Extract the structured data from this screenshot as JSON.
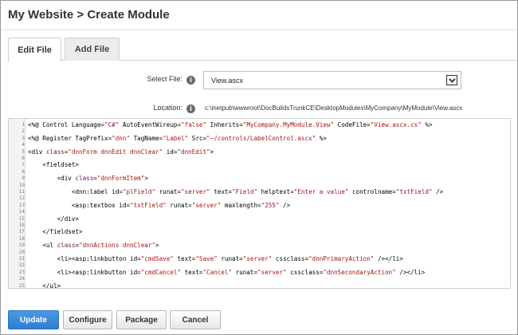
{
  "page": {
    "title": "My Website > Create Module"
  },
  "tabs": [
    {
      "label": "Edit File",
      "active": true
    },
    {
      "label": "Add File",
      "active": false
    }
  ],
  "form": {
    "select_file_label": "Select File:",
    "select_file_value": "View.ascx",
    "location_label": "Location:",
    "location_value": "c:\\inetpub\\wwwroot\\DocBuildsTrunkCE\\DesktopModules\\MyCompany\\MyModule\\View.ascx",
    "info_glyph": "i"
  },
  "editor": {
    "line_numbers": [
      "1",
      "2",
      "3",
      "4",
      "5",
      "6",
      "7",
      "8",
      "9",
      "10",
      "11",
      "12",
      "13",
      "14",
      "15",
      "16",
      "17",
      "18",
      "19",
      "20",
      "21",
      "22",
      "23",
      "24",
      "25"
    ],
    "code_lines": [
      [
        {
          "t": "<%@ Control Language=",
          "c": ""
        },
        {
          "t": "\"C#\"",
          "c": "str"
        },
        {
          "t": " AutoEventWireup=",
          "c": ""
        },
        {
          "t": "\"false\"",
          "c": "str"
        },
        {
          "t": " Inherits=",
          "c": ""
        },
        {
          "t": "\"MyCompany.MyModule.View\"",
          "c": "str"
        },
        {
          "t": " CodeFile=",
          "c": ""
        },
        {
          "t": "\"View.ascx.cs\"",
          "c": "str"
        },
        {
          "t": " %>",
          "c": ""
        }
      ],
      [
        {
          "t": "<%@ Register TagPrefix=",
          "c": ""
        },
        {
          "t": "\"dnn\"",
          "c": "str"
        },
        {
          "t": " TagName=",
          "c": ""
        },
        {
          "t": "\"Label\"",
          "c": "str"
        },
        {
          "t": " Src=",
          "c": ""
        },
        {
          "t": "\"~/controls/LabelControl.ascx\"",
          "c": "str"
        },
        {
          "t": " %>",
          "c": ""
        }
      ],
      [
        {
          "t": "<div ",
          "c": ""
        },
        {
          "t": "class",
          "c": "kw"
        },
        {
          "t": "=",
          "c": ""
        },
        {
          "t": "\"dnnForm dnnEdit dnnClear\"",
          "c": "str"
        },
        {
          "t": " id=",
          "c": ""
        },
        {
          "t": "\"dnnEdit\"",
          "c": "str"
        },
        {
          "t": ">",
          "c": ""
        }
      ],
      [
        {
          "t": "    <fieldset>",
          "c": ""
        }
      ],
      [
        {
          "t": "        <div ",
          "c": ""
        },
        {
          "t": "class",
          "c": "kw"
        },
        {
          "t": "=",
          "c": ""
        },
        {
          "t": "\"dnnFormItem\"",
          "c": "str"
        },
        {
          "t": ">",
          "c": ""
        }
      ],
      [
        {
          "t": "            <dnn:label id=",
          "c": ""
        },
        {
          "t": "\"plField\"",
          "c": "str"
        },
        {
          "t": " runat=",
          "c": ""
        },
        {
          "t": "\"server\"",
          "c": "str"
        },
        {
          "t": " text=",
          "c": ""
        },
        {
          "t": "\"Field\"",
          "c": "str"
        },
        {
          "t": " helptext=",
          "c": ""
        },
        {
          "t": "\"Enter a value\"",
          "c": "str"
        },
        {
          "t": " controlname=",
          "c": ""
        },
        {
          "t": "\"txtField\"",
          "c": "str"
        },
        {
          "t": " />",
          "c": ""
        }
      ],
      [
        {
          "t": "            <asp:textbox id=",
          "c": ""
        },
        {
          "t": "\"txtField\"",
          "c": "str"
        },
        {
          "t": " runat=",
          "c": ""
        },
        {
          "t": "\"server\"",
          "c": "str"
        },
        {
          "t": " maxlength=",
          "c": ""
        },
        {
          "t": "\"255\"",
          "c": "str"
        },
        {
          "t": " />",
          "c": ""
        }
      ],
      [
        {
          "t": "        </div>",
          "c": ""
        }
      ],
      [
        {
          "t": "    </fieldset>",
          "c": ""
        }
      ],
      [
        {
          "t": "    <ul ",
          "c": ""
        },
        {
          "t": "class",
          "c": "kw"
        },
        {
          "t": "=",
          "c": ""
        },
        {
          "t": "\"dnnActions dnnClear\"",
          "c": "str"
        },
        {
          "t": ">",
          "c": ""
        }
      ],
      [
        {
          "t": "        <li><asp:linkbutton id=",
          "c": ""
        },
        {
          "t": "\"cmdSave\"",
          "c": "str"
        },
        {
          "t": " text=",
          "c": ""
        },
        {
          "t": "\"Save\"",
          "c": "str"
        },
        {
          "t": " runat=",
          "c": ""
        },
        {
          "t": "\"server\"",
          "c": "str"
        },
        {
          "t": " cssclass=",
          "c": ""
        },
        {
          "t": "\"dnnPrimaryAction\"",
          "c": "str"
        },
        {
          "t": " /></li>",
          "c": ""
        }
      ],
      [
        {
          "t": "        <li><asp:linkbutton id=",
          "c": ""
        },
        {
          "t": "\"cmdCancel\"",
          "c": "str"
        },
        {
          "t": " text=",
          "c": ""
        },
        {
          "t": "\"Cancel\"",
          "c": "str"
        },
        {
          "t": " runat=",
          "c": ""
        },
        {
          "t": "\"server\"",
          "c": "str"
        },
        {
          "t": " cssclass=",
          "c": ""
        },
        {
          "t": "\"dnnSecondaryAction\"",
          "c": "str"
        },
        {
          "t": " /></li>",
          "c": ""
        }
      ],
      [
        {
          "t": "    </ul>",
          "c": ""
        }
      ]
    ]
  },
  "actions": {
    "update": "Update",
    "configure": "Configure",
    "package": "Package",
    "cancel": "Cancel"
  }
}
